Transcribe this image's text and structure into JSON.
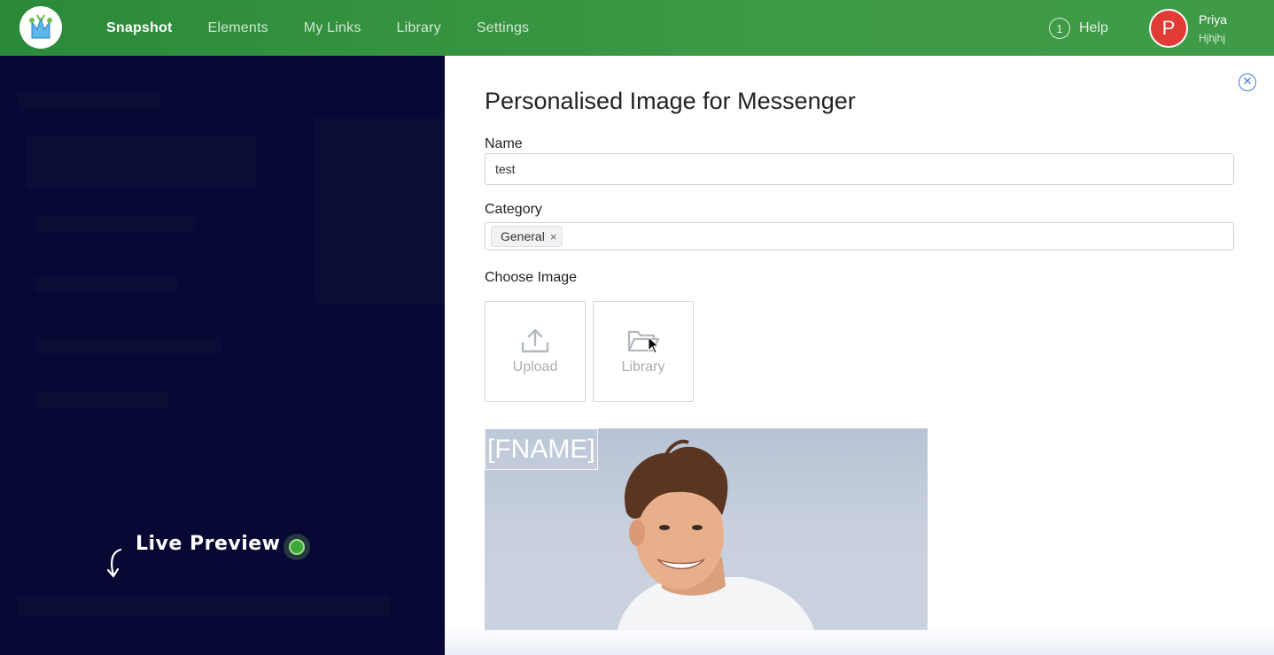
{
  "topbar": {
    "nav": [
      {
        "label": "Snapshot",
        "active": true
      },
      {
        "label": "Elements",
        "active": false
      },
      {
        "label": "My Links",
        "active": false
      },
      {
        "label": "Library",
        "active": false
      },
      {
        "label": "Settings",
        "active": false
      }
    ],
    "help_label": "Help",
    "help_icon_glyph": "1",
    "user": {
      "initial": "P",
      "name": "Priya",
      "subtitle": "Hjhjhj"
    },
    "colors": {
      "bar": "#3d9a45",
      "avatar": "#e23a35"
    }
  },
  "left": {
    "live_preview_label": "Live Preview"
  },
  "panel": {
    "title": "Personalised Image for Messenger",
    "close_glyph": "✕",
    "name_label": "Name",
    "name_value": "test",
    "category_label": "Category",
    "category_tags": [
      "General"
    ],
    "tag_remove_glyph": "×",
    "choose_image_label": "Choose Image",
    "upload_label": "Upload",
    "library_label": "Library",
    "preview_placeholder": "[FNAME]"
  },
  "icons": {
    "logo": "logo-icon",
    "help": "info-circle-icon",
    "close": "close-circle-icon",
    "upload": "upload-icon",
    "library": "folder-open-icon",
    "cursor": "mouse-pointer-icon",
    "live_arrow": "curved-arrow-icon"
  }
}
